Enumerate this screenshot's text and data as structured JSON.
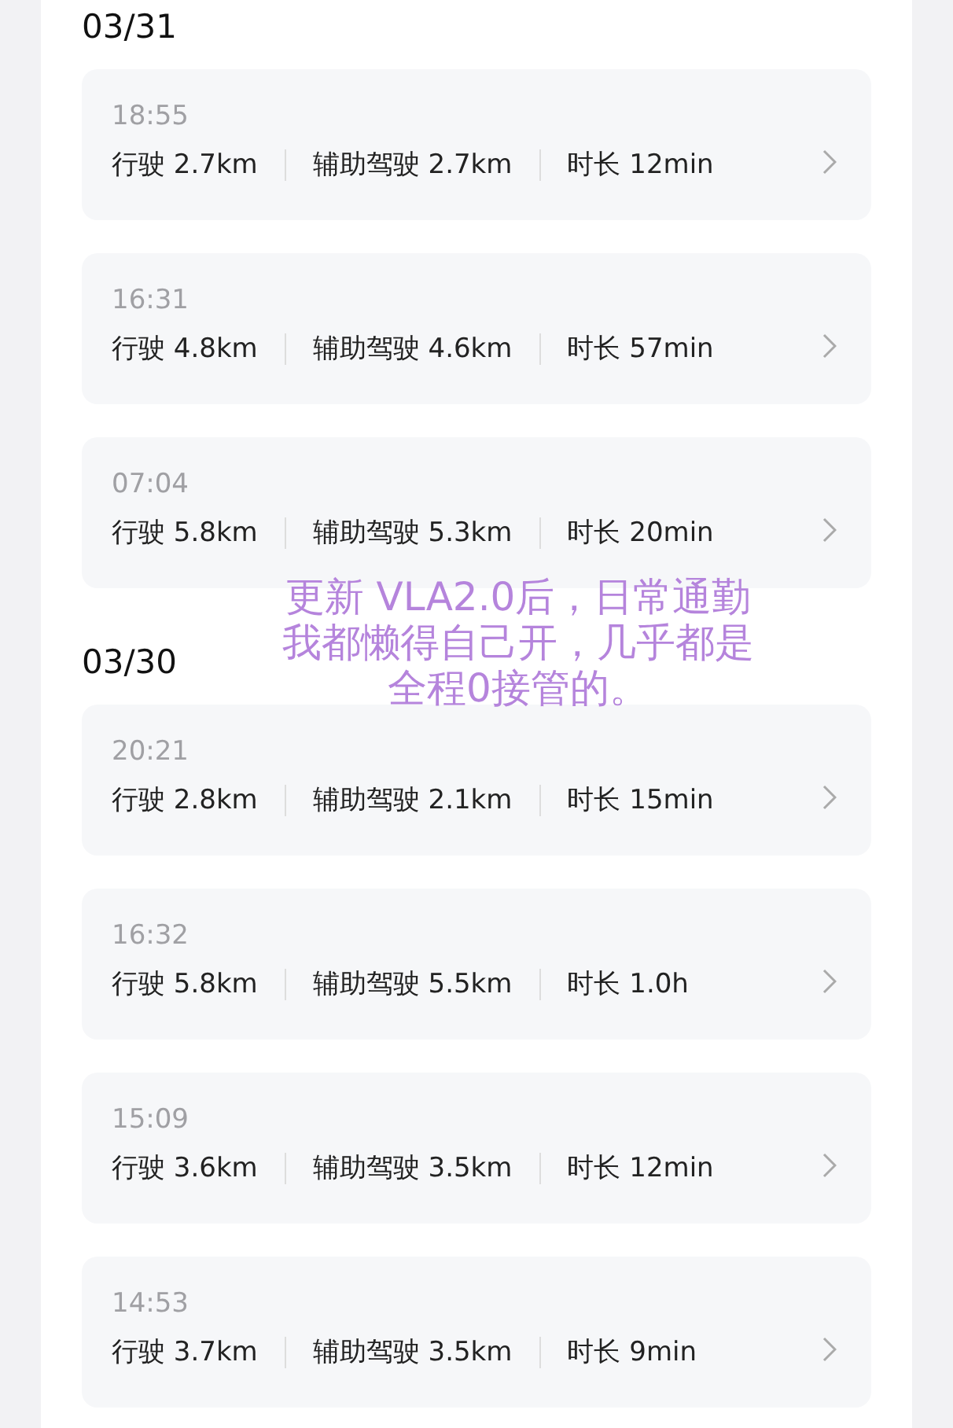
{
  "groups": [
    {
      "date": "03/31",
      "trips": [
        {
          "time": "18:55",
          "drive": "行驶 2.7km",
          "assist": "辅助驾驶 2.7km",
          "duration": "时长 12min"
        },
        {
          "time": "16:31",
          "drive": "行驶 4.8km",
          "assist": "辅助驾驶 4.6km",
          "duration": "时长 57min"
        },
        {
          "time": "07:04",
          "drive": "行驶 5.8km",
          "assist": "辅助驾驶 5.3km",
          "duration": "时长 20min"
        }
      ]
    },
    {
      "date": "03/30",
      "trips": [
        {
          "time": "20:21",
          "drive": "行驶 2.8km",
          "assist": "辅助驾驶 2.1km",
          "duration": "时长 15min"
        },
        {
          "time": "16:32",
          "drive": "行驶 5.8km",
          "assist": "辅助驾驶 5.5km",
          "duration": "时长 1.0h"
        },
        {
          "time": "15:09",
          "drive": "行驶 3.6km",
          "assist": "辅助驾驶 3.5km",
          "duration": "时长 12min"
        },
        {
          "time": "14:53",
          "drive": "行驶 3.7km",
          "assist": "辅助驾驶 3.5km",
          "duration": "时长 9min"
        }
      ]
    }
  ],
  "caption": "更新 VLA2.0后，日常通勤我都懒得自己开，几乎都是全程0接管的。"
}
